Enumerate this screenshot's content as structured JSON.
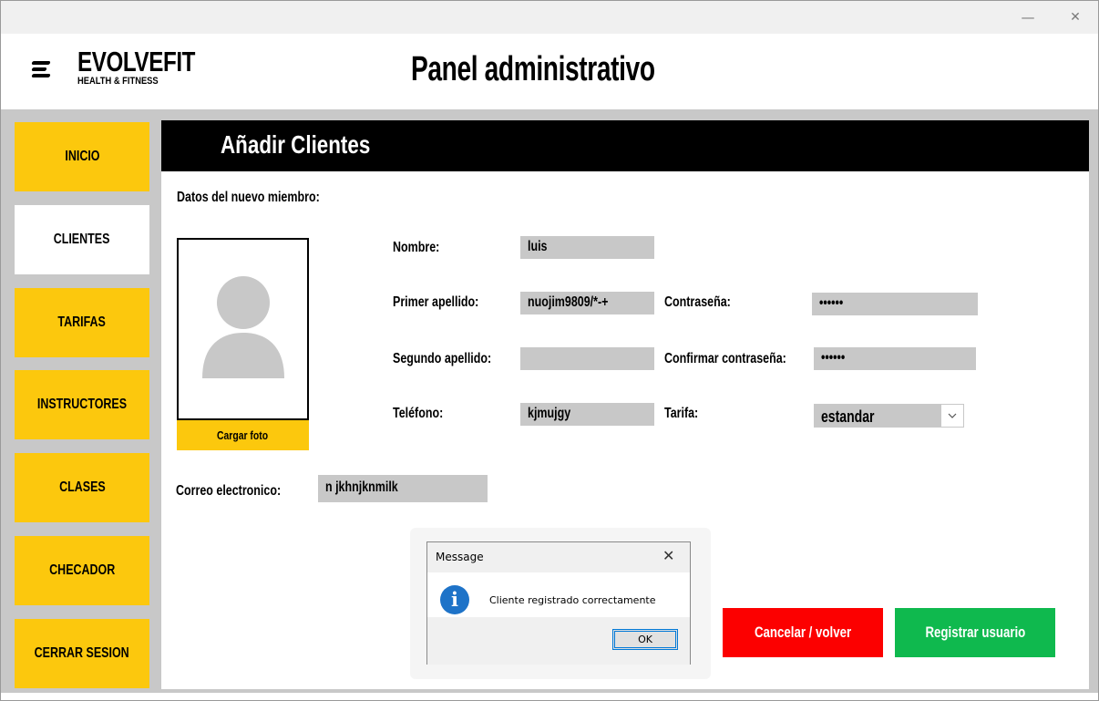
{
  "window": {
    "minimize_glyph": "—",
    "close_glyph": "✕"
  },
  "brand": {
    "name": "EVOLVEFIT",
    "tagline": "HEALTH & FITNESS"
  },
  "header": {
    "title": "Panel administrativo"
  },
  "sidebar": {
    "items": [
      {
        "label": "INICIO",
        "active": false
      },
      {
        "label": "CLIENTES",
        "active": true
      },
      {
        "label": "TARIFAS",
        "active": false
      },
      {
        "label": "INSTRUCTORES",
        "active": false
      },
      {
        "label": "CLASES",
        "active": false
      },
      {
        "label": "CHECADOR",
        "active": false
      },
      {
        "label": "CERRAR SESION",
        "active": false
      }
    ]
  },
  "section": {
    "title": "Añadir Clientes",
    "subtitle": "Datos del nuevo miembro:"
  },
  "photo": {
    "upload_label": "Cargar foto"
  },
  "form": {
    "nombre_label": "Nombre:",
    "nombre_value": "luis",
    "primer_apellido_label": "Primer apellido:",
    "primer_apellido_value": "nuojim9809/*-+",
    "segundo_apellido_label": "Segundo apellido:",
    "segundo_apellido_value": "",
    "telefono_label": "Teléfono:",
    "telefono_value": "kjmujgy",
    "contrasena_label": "Contraseña:",
    "contrasena_value": "••••••",
    "confirmar_label": "Confirmar contraseña:",
    "confirmar_value": "••••••",
    "tarifa_label": "Tarifa:",
    "tarifa_value": "estandar",
    "correo_label": "Correo electronico:",
    "correo_value": "n jkhnjknmilk"
  },
  "actions": {
    "cancel_label": "Cancelar / volver",
    "register_label": "Registrar usuario"
  },
  "dialog": {
    "title": "Message",
    "close_glyph": "✕",
    "icon_glyph": "i",
    "message": "Cliente registrado correctamente",
    "ok_label": "OK"
  },
  "colors": {
    "accent_yellow": "#fcc80d",
    "cancel_red": "#fc0000",
    "register_green": "#0fb94e",
    "field_gray": "#c8c8c8",
    "info_blue": "#1e73c8"
  }
}
